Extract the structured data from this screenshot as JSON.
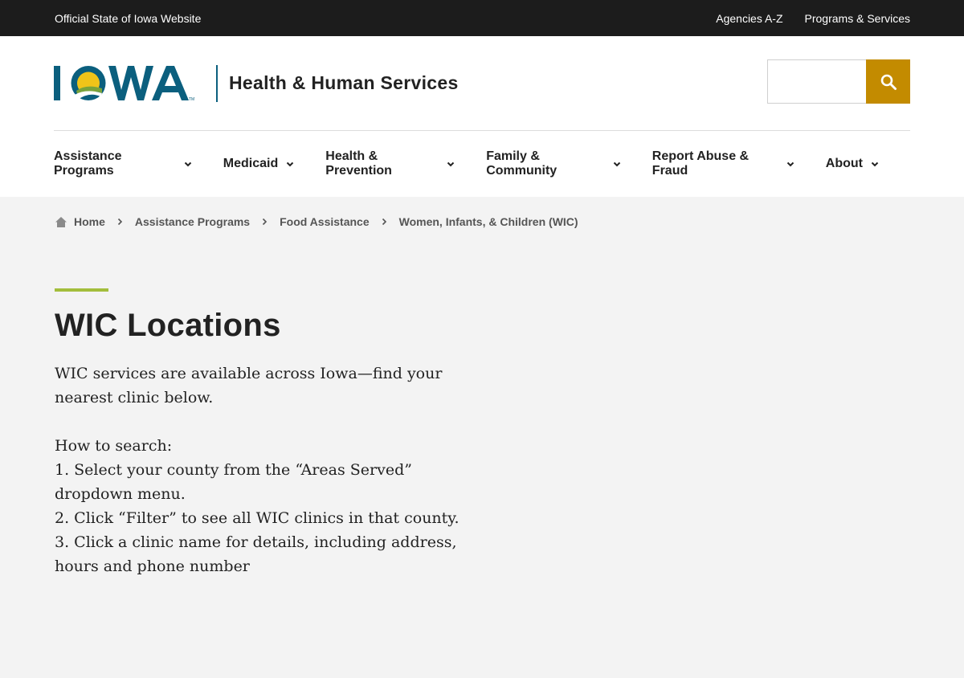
{
  "topbar": {
    "official_label": "Official State of Iowa Website",
    "links": [
      "Agencies A-Z",
      "Programs & Services"
    ]
  },
  "header": {
    "logo_text": "IOWA",
    "agency_name": "Health & Human Services",
    "search": {
      "placeholder": "",
      "value": ""
    }
  },
  "nav": {
    "items": [
      {
        "label": "Assistance Programs"
      },
      {
        "label": "Medicaid"
      },
      {
        "label": "Health & Prevention"
      },
      {
        "label": "Family & Community"
      },
      {
        "label": "Report Abuse & Fraud"
      },
      {
        "label": "About"
      }
    ]
  },
  "breadcrumb": {
    "items": [
      "Home",
      "Assistance Programs",
      "Food Assistance",
      "Women, Infants, & Children (WIC)"
    ]
  },
  "main": {
    "title": "WIC Locations",
    "intro": "WIC services are available across Iowa—find your nearest clinic below.",
    "howto_heading": "How to search:",
    "steps": [
      "1. Select your county from the “Areas Served” dropdown menu.",
      "2. Click “Filter” to see all WIC clinics in that county.",
      "3. Click a clinic name for details, including address, hours and phone number"
    ]
  },
  "colors": {
    "topbar_bg": "#1c1c1c",
    "logo_blue": "#0b5f7e",
    "logo_sun": "#f0c419",
    "logo_green": "#7aa33a",
    "search_button": "#c38b00",
    "accent_bar": "#a3be3c",
    "page_bg": "#f3f3f3"
  },
  "icons": {
    "search": "search-icon",
    "home": "home-icon",
    "chevron_down": "chevron-down-icon",
    "chevron_right": "chevron-right-icon"
  }
}
